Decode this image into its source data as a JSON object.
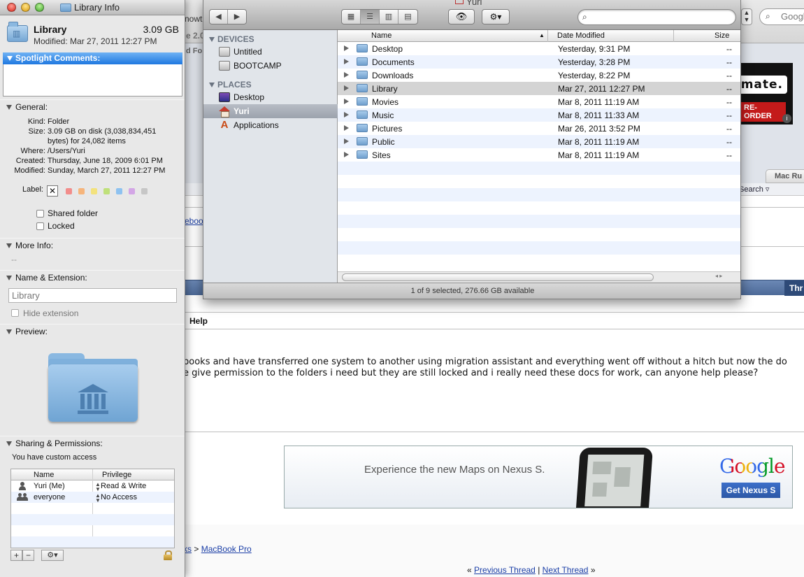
{
  "info_window": {
    "title": "Library Info",
    "name": "Library",
    "size": "3.09 GB",
    "modified": "Modified: Mar 27, 2011 12:27 PM",
    "spotlight_header": "Spotlight Comments:",
    "general_header": "General:",
    "general": [
      {
        "k": "Kind:",
        "v": "Folder"
      },
      {
        "k": "Size:",
        "v": "3.09 GB on disk (3,038,834,451 bytes) for 24,082 items"
      },
      {
        "k": "Where:",
        "v": "/Users/Yuri"
      },
      {
        "k": "Created:",
        "v": "Thursday, June 18, 2009 6:01 PM"
      },
      {
        "k": "Modified:",
        "v": "Sunday, March 27, 2011 12:27 PM"
      }
    ],
    "label_key": "Label:",
    "label_none": "✕",
    "label_colors": [
      "#f28d8b",
      "#f6b57c",
      "#f3e27d",
      "#bfe07a",
      "#8ec2f0",
      "#d3a6e6",
      "#c6c6c6"
    ],
    "shared_folder": "Shared folder",
    "locked": "Locked",
    "more_info_header": "More Info:",
    "more_info_value": "--",
    "name_ext_header": "Name & Extension:",
    "name_field_value": "Library",
    "hide_extension": "Hide extension",
    "preview_header": "Preview:",
    "sharing_header": "Sharing & Permissions:",
    "custom_access": "You have custom access",
    "perm_columns": {
      "name": "Name",
      "privilege": "Privilege"
    },
    "permissions": [
      {
        "name": "Yuri (Me)",
        "privilege": "Read & Write"
      },
      {
        "name": "everyone",
        "privilege": "No Access"
      }
    ],
    "add_btn": "+",
    "remove_btn": "−",
    "action_btn": "⚙▾"
  },
  "finder": {
    "title": "Yuri",
    "view_buttons": [
      "▦",
      "☰",
      "▥",
      "▤"
    ],
    "quicklook": "👁",
    "action": "⚙▾",
    "search_icon": "search-icon",
    "search_placeholder": "",
    "sidebar": {
      "devices_header": "DEVICES",
      "devices": [
        "Untitled",
        "BOOTCAMP"
      ],
      "places_header": "PLACES",
      "places": [
        "Desktop",
        "Yuri",
        "Applications"
      ]
    },
    "columns": {
      "name": "Name",
      "date": "Date Modified",
      "size": "Size"
    },
    "rows": [
      {
        "name": "Desktop",
        "date": "Yesterday, 9:31 PM",
        "size": "--"
      },
      {
        "name": "Documents",
        "date": "Yesterday, 3:28 PM",
        "size": "--"
      },
      {
        "name": "Downloads",
        "date": "Yesterday, 8:22 PM",
        "size": "--"
      },
      {
        "name": "Library",
        "date": "Mar 27, 2011 12:27 PM",
        "size": "--"
      },
      {
        "name": "Movies",
        "date": "Mar 8, 2011 11:19 AM",
        "size": "--"
      },
      {
        "name": "Music",
        "date": "Mar 8, 2011 11:33 AM",
        "size": "--"
      },
      {
        "name": "Pictures",
        "date": "Mar 26, 2011 3:52 PM",
        "size": "--"
      },
      {
        "name": "Public",
        "date": "Mar 8, 2011 11:19 AM",
        "size": "--"
      },
      {
        "name": "Sites",
        "date": "Mar 8, 2011 11:19 AM",
        "size": "--"
      }
    ],
    "status": "1 of 9 selected, 276.66 GB available"
  },
  "background_page": {
    "url_field": "Google",
    "frag1": "nowt",
    "frag2": "e 2.0",
    "frag3": "d Fo",
    "ad_text": "mate.",
    "ad_preorder": "RE-ORDER",
    "tab_label": "Mac Ru",
    "search_link": "Search",
    "link_frag": "ebooks",
    "blue_bar_label": "Thr",
    "help_heading": "Help",
    "post_line1": "books and have transferred one system to another using migration assistant and everything went off without a hitch but now the do",
    "post_line2": "e give permission to the folders i need but they are still locked and i really need these docs for work, can anyone help please?",
    "google_ad_slogan": "Experience the new Maps on Nexus S.",
    "google_logo": "Google",
    "google_button": "Get Nexus S",
    "breadcrumb_frag": "ks",
    "breadcrumb_sep": ">",
    "breadcrumb_last": "MacBook Pro",
    "prev_thread": "Previous Thread",
    "next_thread": "Next Thread",
    "thread_sep": "|",
    "laquo": "«",
    "raquo": "»"
  },
  "colors": {
    "selection_blue": "#1f78e0",
    "ad_red": "#c41a1a",
    "link_blue": "#1a3ea6"
  }
}
